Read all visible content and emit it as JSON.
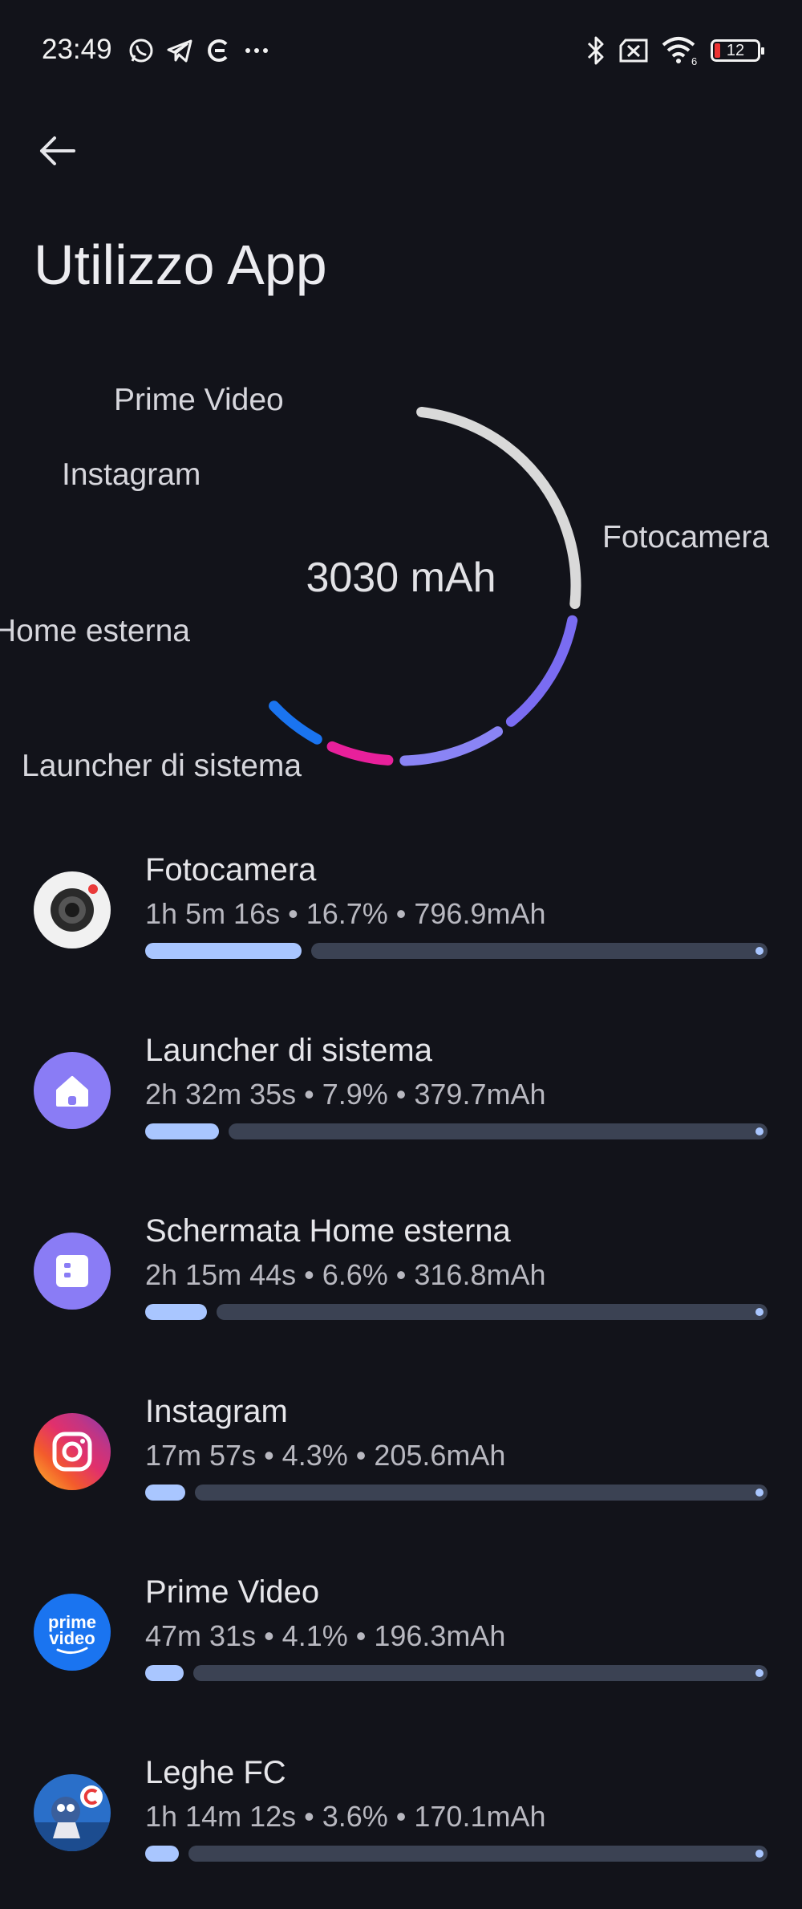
{
  "status_bar": {
    "time": "23:49",
    "notification_icons": [
      "whatsapp-icon",
      "telegram-icon",
      "leghe-fc-icon",
      "more-dots-icon"
    ],
    "system_icons": [
      "bluetooth-icon",
      "no-sim-icon",
      "wifi-icon"
    ],
    "wifi_badge": "6",
    "battery_level": "12"
  },
  "header": {
    "title": "Utilizzo App"
  },
  "donut": {
    "center_label": "3030 mAh",
    "segments": [
      {
        "label": "Fotocamera",
        "color": "#d9d9d9",
        "share": 0.263
      },
      {
        "label": "Launcher di sistema",
        "color": "#7a6cf2",
        "share": 0.125
      },
      {
        "label": "Schermata Home esterna",
        "color": "#8a84f5",
        "share": 0.105
      },
      {
        "label": "Instagram",
        "color": "#e8209b",
        "share": 0.068
      },
      {
        "label": "Prime Video",
        "color": "#1a74f0",
        "share": 0.065
      }
    ],
    "labels": {
      "fotocamera": "Fotocamera",
      "launcher": "Launcher di sistema",
      "home": "Home esterna",
      "instagram": "Instagram",
      "prime": "Prime Video"
    }
  },
  "apps": [
    {
      "name": "Fotocamera",
      "detail": "1h 5m 16s • 16.7% • 796.9mAh",
      "percent": 16.7
    },
    {
      "name": "Launcher di sistema",
      "detail": "2h 32m 35s • 7.9% • 379.7mAh",
      "percent": 7.9
    },
    {
      "name": "Schermata Home esterna",
      "detail": "2h 15m 44s • 6.6% • 316.8mAh",
      "percent": 6.6
    },
    {
      "name": "Instagram",
      "detail": "17m 57s • 4.3% • 205.6mAh",
      "percent": 4.3
    },
    {
      "name": "Prime Video",
      "detail": "47m 31s • 4.1% • 196.3mAh",
      "percent": 4.1,
      "icon_text_1": "prime",
      "icon_text_2": "video"
    },
    {
      "name": "Leghe FC",
      "detail": "1h 14m 12s • 3.6% • 170.1mAh",
      "percent": 3.6
    }
  ],
  "colors": {
    "background": "#12131a",
    "bar_fill": "#a9c6ff",
    "bar_track": "#3b4253"
  }
}
